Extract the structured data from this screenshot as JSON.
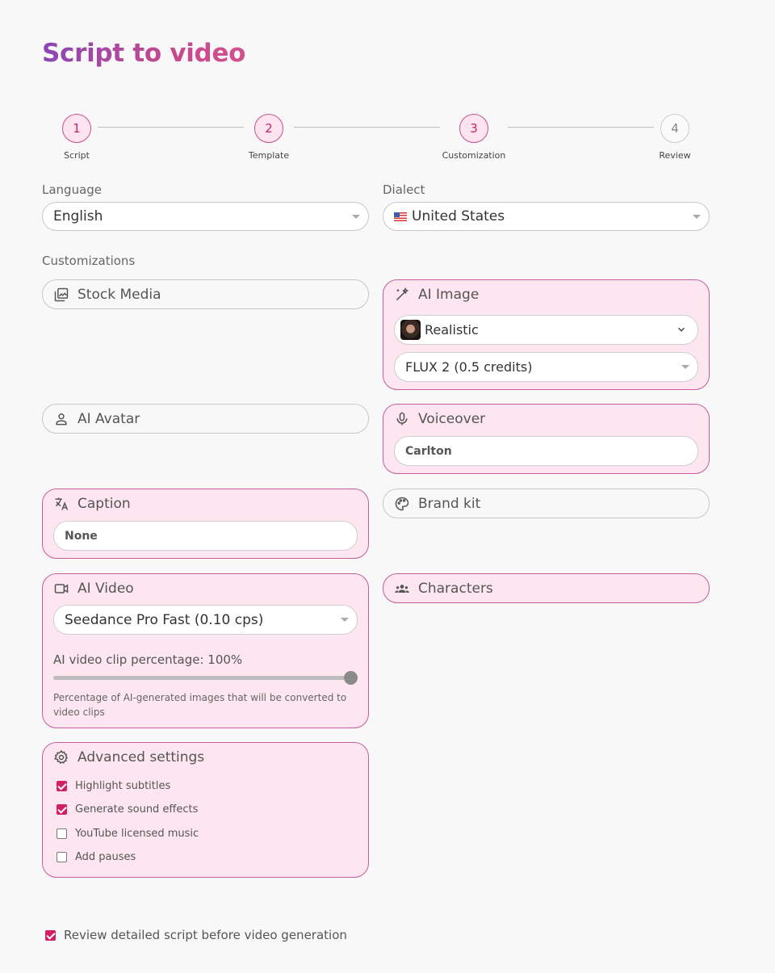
{
  "page_title": "Script to video",
  "steps": [
    {
      "number": "1",
      "label": "Script"
    },
    {
      "number": "2",
      "label": "Template"
    },
    {
      "number": "3",
      "label": "Customization"
    },
    {
      "number": "4",
      "label": "Review"
    }
  ],
  "language": {
    "label": "Language",
    "value": "English"
  },
  "dialect": {
    "label": "Dialect",
    "value": "United States",
    "flag_icon": "us-flag-icon"
  },
  "customizations": {
    "label": "Customizations",
    "stock_media": {
      "label": "Stock Media",
      "icon": "image-stack-icon"
    },
    "ai_image": {
      "label": "AI Image",
      "icon": "magic-pen-icon",
      "style": "Realistic",
      "model": "FLUX 2 (0.5 credits)"
    },
    "ai_avatar": {
      "label": "AI Avatar",
      "icon": "person-icon"
    },
    "voiceover": {
      "label": "Voiceover",
      "icon": "microphone-icon",
      "value": "Carlton"
    },
    "caption": {
      "label": "Caption",
      "icon": "translate-icon",
      "value": "None"
    },
    "brand_kit": {
      "label": "Brand kit",
      "icon": "palette-icon"
    },
    "ai_video": {
      "label": "AI Video",
      "icon": "video-camera-icon",
      "model": "Seedance Pro Fast (0.10 cps)",
      "slider_label": "AI video clip percentage: 100%",
      "slider_value": 100,
      "helper": "Percentage of AI-generated images that will be converted to video clips"
    },
    "characters": {
      "label": "Characters",
      "icon": "group-icon"
    },
    "advanced": {
      "label": "Advanced settings",
      "icon": "gear-icon",
      "options": [
        {
          "label": "Highlight subtitles",
          "checked": true
        },
        {
          "label": "Generate sound effects",
          "checked": true
        },
        {
          "label": "YouTube licensed music",
          "checked": false
        },
        {
          "label": "Add pauses",
          "checked": false
        }
      ]
    }
  },
  "review_checkbox": {
    "label": "Review detailed script before video generation",
    "checked": true
  },
  "colors": {
    "accent": "#d21f66",
    "active_bg": "#fde6ef",
    "active_border": "#c35e9a",
    "title_gradient_start": "#8a47b4",
    "title_gradient_end": "#d2508c"
  }
}
